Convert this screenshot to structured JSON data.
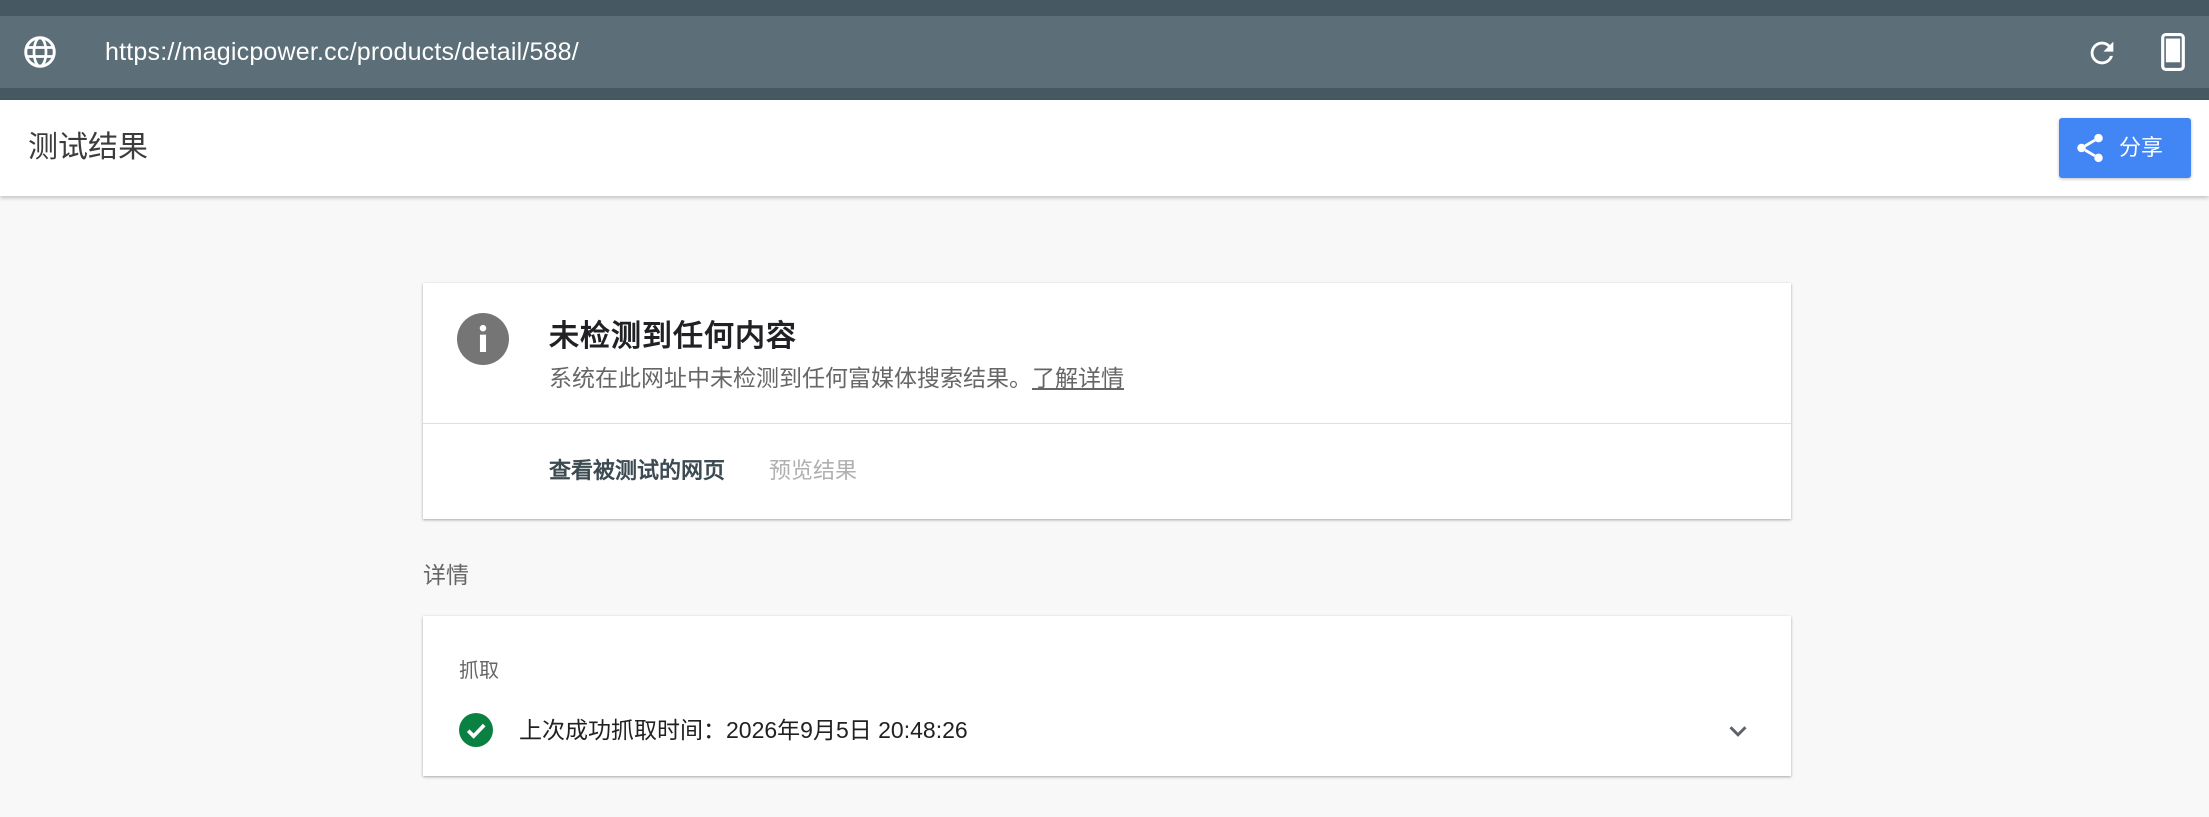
{
  "browser": {
    "url": "https://magicpower.cc/products/detail/588/",
    "icons": {
      "left": "globe-icon",
      "reload": "reload-icon",
      "device": "smartphone-icon"
    }
  },
  "header": {
    "title": "测试结果",
    "share_label": "分享",
    "share_icon": "share-icon",
    "accent_color": "#4285f4"
  },
  "result": {
    "icon": "info-icon",
    "title": "未检测到任何内容",
    "description": "系统在此网址中未检测到任何富媒体搜索结果。",
    "learn_more": "了解详情",
    "tabs": [
      {
        "label": "查看被测试的网页",
        "active": true
      },
      {
        "label": "预览结果",
        "active": false
      }
    ]
  },
  "details": {
    "heading": "详情",
    "fetch": {
      "label": "抓取",
      "status_icon": "check-circle-icon",
      "status_color": "#0b8043",
      "text": "上次成功抓取时间：2026年9月5日 20:48:26",
      "expand_icon": "chevron-down-icon"
    }
  }
}
